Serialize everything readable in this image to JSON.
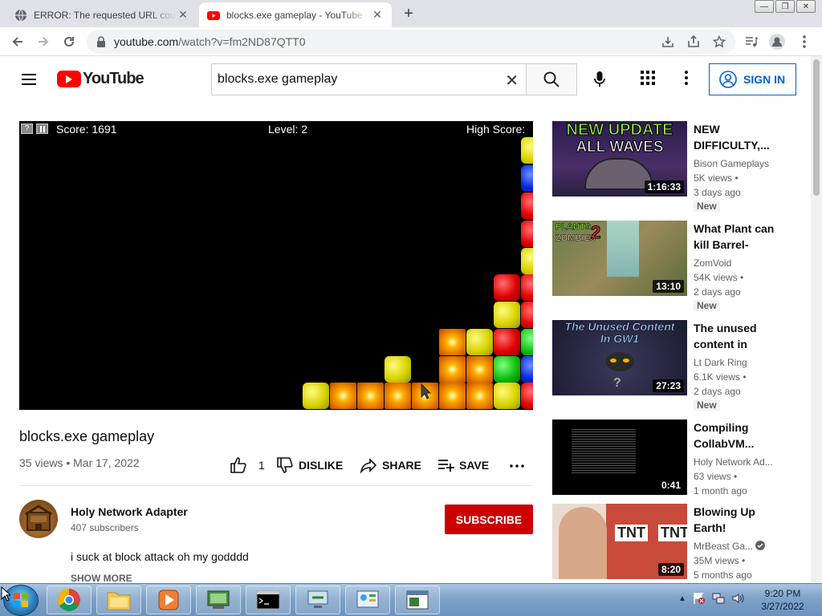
{
  "browser": {
    "tabs": [
      {
        "title": "ERROR: The requested URL could not be retrieved",
        "active": false
      },
      {
        "title": "blocks.exe gameplay - YouTube",
        "active": true
      }
    ],
    "new_tab": "+",
    "url_host": "youtube.com",
    "url_path": "/watch?v=fm2ND87QTT0"
  },
  "header": {
    "logo_text": "YouTube",
    "search_value": "blocks.exe gameplay",
    "sign_in_label": "SIGN IN"
  },
  "player": {
    "score_label": "Score: 1691",
    "level_label": "Level: 2",
    "high_score_label": "High Score:",
    "help_btn": "?"
  },
  "video": {
    "title": "blocks.exe gameplay",
    "meta": "35 views • Mar 17, 2022",
    "like_count": "1",
    "dislike_label": "DISLIKE",
    "share_label": "SHARE",
    "save_label": "SAVE",
    "more_label": "..."
  },
  "channel": {
    "name": "Holy Network Adapter",
    "subscribers": "407 subscribers",
    "subscribe_label": "SUBSCRIBE",
    "description": "i suck at block attack oh my godddd",
    "show_more": "SHOW MORE"
  },
  "recommendations": [
    {
      "title": "NEW DIFFICULTY,...",
      "channel": "Bison Gameplays",
      "views": "5K views •",
      "age": "3 days ago",
      "badge": "New",
      "duration": "1:16:33",
      "thumb_text": [
        "NEW UPDATE",
        "ALL WAVES"
      ]
    },
    {
      "title": "What Plant can kill Barrel-Hea...",
      "channel": "ZomVoid",
      "views": "54K views •",
      "age": "2 days ago",
      "badge": "New",
      "duration": "13:10",
      "thumb_text": [
        "PLANTS",
        "ZOMBIES",
        "2"
      ]
    },
    {
      "title": "The unused content in GW...",
      "channel": "Lt Dark Ring",
      "views": "6.1K views •",
      "age": "2 days ago",
      "badge": "New",
      "duration": "27:23",
      "thumb_text": [
        "The Unused Content",
        "In GW1",
        "?"
      ]
    },
    {
      "title": "Compiling CollabVM...",
      "channel": "Holy Network Ad...",
      "views": "63 views •",
      "age": "1 month ago",
      "badge": "",
      "duration": "0:41",
      "thumb_text": []
    },
    {
      "title": "Blowing Up Earth!",
      "channel": "MrBeast Ga...",
      "views": "35M views •",
      "age": "5 months ago",
      "badge": "",
      "duration": "8:20",
      "thumb_text": [
        "TNT",
        "TNT"
      ]
    }
  ],
  "taskbar": {
    "time": "9:20 PM",
    "date": "3/27/2022"
  },
  "colors": {
    "youtube_red": "#ff0000",
    "subscribe_red": "#cc0000",
    "link_blue": "#065fd4"
  }
}
